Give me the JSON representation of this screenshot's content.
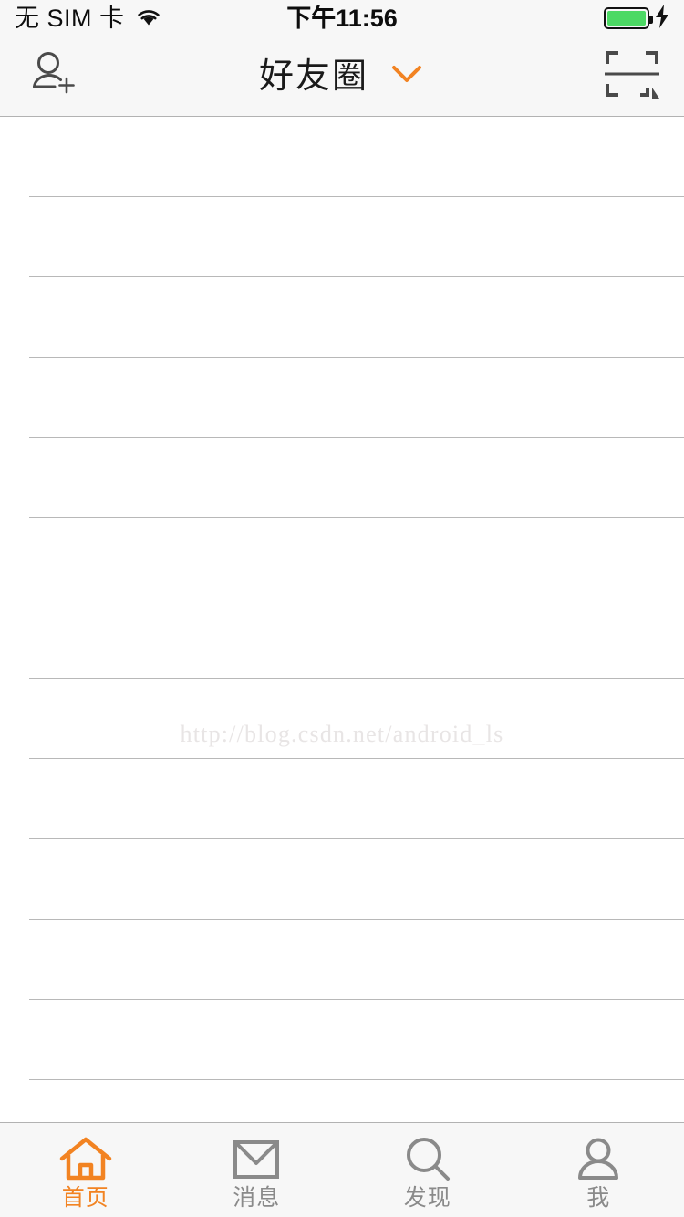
{
  "status_bar": {
    "carrier": "无 SIM 卡",
    "wifi_icon": "wifi-icon",
    "time": "下午11:56",
    "battery_icon": "battery-full-icon",
    "charging_icon": "lightning-bolt-icon"
  },
  "nav_bar": {
    "add_friend_icon": "add-person-icon",
    "title": "好友圈",
    "dropdown_icon": "chevron-down-icon",
    "scan_icon": "qr-scan-icon"
  },
  "content": {
    "watermark": "http://blog.csdn.net/android_ls",
    "rows": [
      {
        "id": "row-1"
      },
      {
        "id": "row-2"
      },
      {
        "id": "row-3"
      },
      {
        "id": "row-4"
      },
      {
        "id": "row-5"
      },
      {
        "id": "row-6"
      },
      {
        "id": "row-7"
      },
      {
        "id": "row-8"
      },
      {
        "id": "row-9"
      },
      {
        "id": "row-10"
      },
      {
        "id": "row-11"
      },
      {
        "id": "row-12"
      }
    ]
  },
  "tab_bar": {
    "items": [
      {
        "label": "首页",
        "icon": "home-icon",
        "active": true
      },
      {
        "label": "消息",
        "icon": "envelope-icon",
        "active": false
      },
      {
        "label": "发现",
        "icon": "search-icon",
        "active": false
      },
      {
        "label": "我",
        "icon": "person-icon",
        "active": false
      }
    ]
  },
  "colors": {
    "accent": "#f28322",
    "inactive": "#8a8a8a",
    "bar_background": "#f7f7f7",
    "separator": "#b8b8b8",
    "battery_green": "#4cd964"
  }
}
